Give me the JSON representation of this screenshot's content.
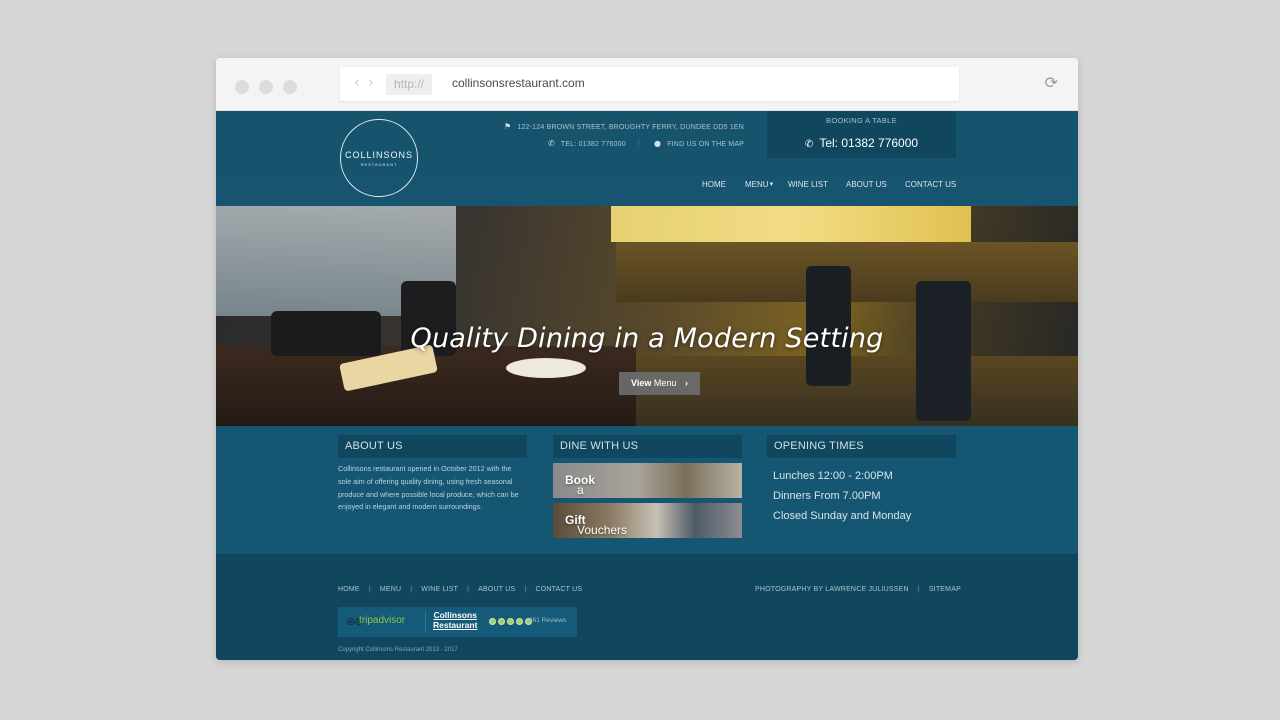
{
  "browser": {
    "protocol": "http://",
    "url": "collinsonsrestaurant.com",
    "back": "‹",
    "forward": "›",
    "reload": "⟳"
  },
  "header": {
    "logo_main": "COLLINSONS",
    "logo_sub": "RESTAURANT",
    "address": "122-124 BROWN STREET, BROUGHTY FERRY, DUNDEE DD5 1EN",
    "tel_small": "TEL: 01382 776000",
    "separator": "|",
    "map_link": "FIND US ON THE MAP",
    "booking_title": "BOOKING A TABLE",
    "booking_tel": "Tel: 01382 776000",
    "nav": {
      "home": "HOME",
      "menu": "MENU",
      "wine": "WINE LIST",
      "about": "ABOUT US",
      "contact": "CONTACT US"
    }
  },
  "hero": {
    "title": "Quality Dining in a Modern Setting",
    "button_bold": "View",
    "button_rest": " Menu",
    "button_arrow": "›"
  },
  "sections": {
    "about_title": "ABOUT US",
    "about_text": "Collinsons restaurant opened in October 2012 with the sole aim of offering quality dining, using fresh seasonal produce and where possible local produce, which can be enjoyed in elegant and modern surroundings.",
    "dine_title": "DINE WITH US",
    "book_bold": "Book",
    "book_rest": " a Table",
    "gift_bold": "Gift",
    "gift_rest": " Vouchers",
    "opening_title": "OPENING TIMES",
    "times": [
      "Lunches 12:00 - 2:00PM",
      "Dinners From 7.00PM",
      "Closed Sunday and Monday"
    ]
  },
  "footer": {
    "links": [
      "HOME",
      "MENU",
      "WINE LIST",
      "ABOUT US",
      "CONTACT US"
    ],
    "photo_credit": "PHOTOGRAPHY BY LAWRENCE JULIUSSEN",
    "sitemap": "SITEMAP",
    "pipe": "|",
    "tripadvisor": "tripadvisor",
    "ta_name_1": "Collinsons",
    "ta_name_2": "Restaurant",
    "ta_reviews": "361 Reviews",
    "ta_rating": 5,
    "copyright": "Copyright Collinsons Restaurant 2013 - 2017"
  },
  "colors": {
    "site_blue": "#155470",
    "header_dark": "#10475f",
    "tripadvisor_green": "#8ec54a"
  }
}
